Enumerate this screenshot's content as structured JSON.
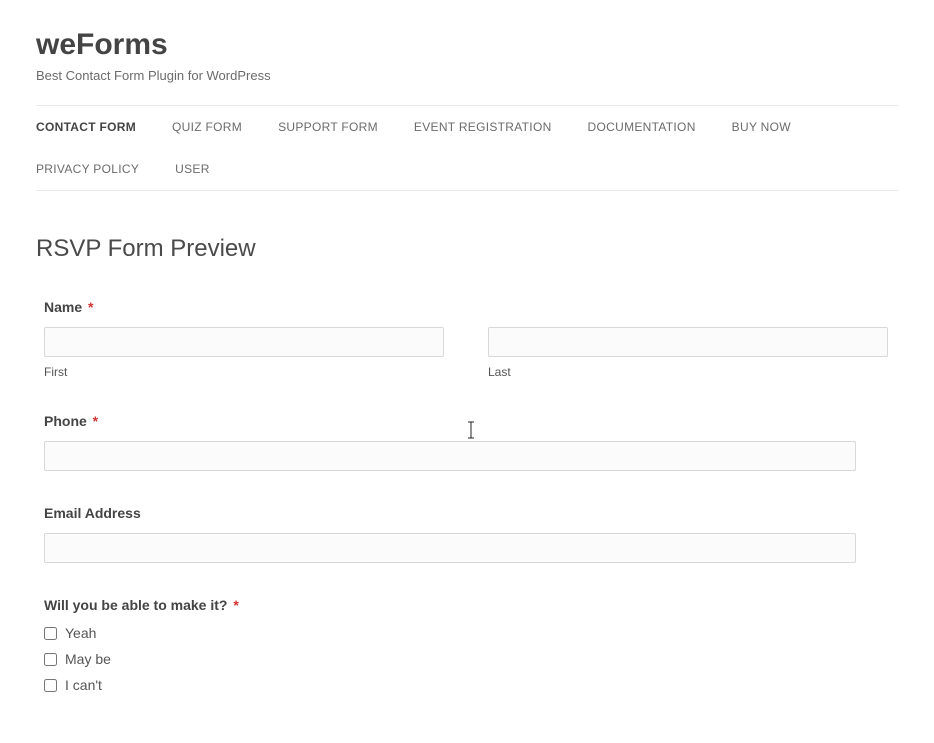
{
  "site": {
    "title": "weForms",
    "tagline": "Best Contact Form Plugin for WordPress"
  },
  "nav": [
    {
      "label": "CONTACT FORM",
      "active": true
    },
    {
      "label": "QUIZ FORM",
      "active": false
    },
    {
      "label": "SUPPORT FORM",
      "active": false
    },
    {
      "label": "EVENT REGISTRATION",
      "active": false
    },
    {
      "label": "DOCUMENTATION",
      "active": false
    },
    {
      "label": "BUY NOW",
      "active": false
    },
    {
      "label": "PRIVACY POLICY",
      "active": false
    },
    {
      "label": "USER",
      "active": false
    }
  ],
  "page": {
    "title": "RSVP Form Preview"
  },
  "form": {
    "name": {
      "label": "Name",
      "required": true,
      "first": {
        "value": "",
        "sublabel": "First"
      },
      "last": {
        "value": "",
        "sublabel": "Last"
      }
    },
    "phone": {
      "label": "Phone",
      "required": true,
      "value": ""
    },
    "email": {
      "label": "Email Address",
      "required": false,
      "value": ""
    },
    "attend": {
      "label": "Will you be able to make it?",
      "required": true,
      "options": [
        {
          "label": "Yeah",
          "checked": false
        },
        {
          "label": "May be",
          "checked": false
        },
        {
          "label": "I can't",
          "checked": false
        }
      ]
    },
    "required_marker": "*"
  }
}
